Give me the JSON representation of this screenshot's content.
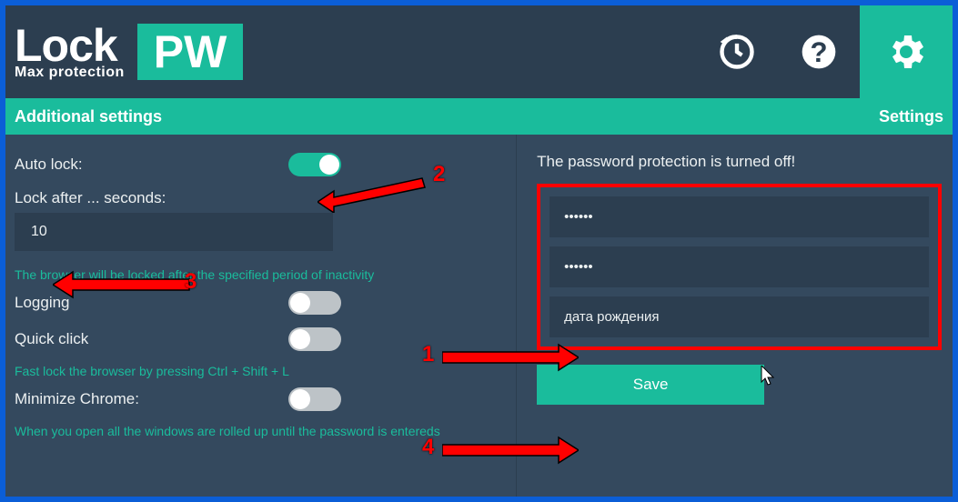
{
  "logo": {
    "name": "Lock",
    "suffix": "PW",
    "tagline": "Max protection"
  },
  "greenbar": {
    "left": "Additional settings",
    "right": "Settings"
  },
  "left": {
    "auto_lock_label": "Auto lock:",
    "auto_lock_on": true,
    "lock_after_label": "Lock after ... seconds:",
    "lock_after_value": "10",
    "lock_after_hint": "The browser will be locked after the specified period of inactivity",
    "logging_label": "Logging",
    "logging_on": false,
    "quick_click_label": "Quick click",
    "quick_click_on": false,
    "quick_click_hint": "Fast lock the browser by pressing Ctrl + Shift + L",
    "minimize_label": "Minimize Chrome:",
    "minimize_on": false,
    "minimize_hint": "When you open all the windows are rolled up until the password is entereds"
  },
  "right": {
    "status": "The password protection is turned off!",
    "password1": "••••••",
    "password2": "••••••",
    "hint_value": "дата рождения",
    "save_label": "Save"
  },
  "annotations": {
    "n1": "1",
    "n2": "2",
    "n3": "3",
    "n4": "4"
  },
  "colors": {
    "accent": "#1abc9c",
    "danger": "#ff0000",
    "blue_frame": "#0b5ed7"
  }
}
